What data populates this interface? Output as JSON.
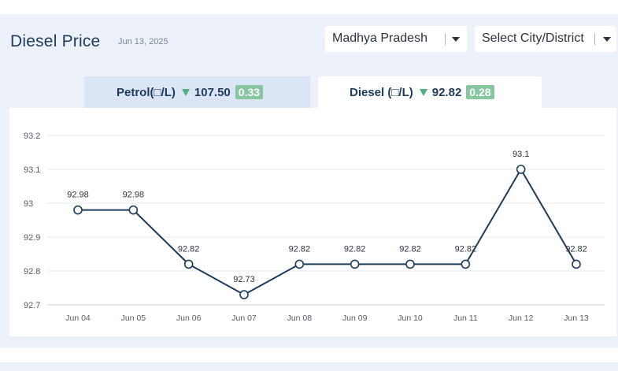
{
  "header": {
    "title": "Diesel Price",
    "date": "Jun 13, 2025",
    "state_select": "Madhya Pradesh",
    "city_select": "Select City/District"
  },
  "tabs": [
    {
      "label": "Petrol(□/L)",
      "price": "107.50",
      "change": "0.33",
      "active": false
    },
    {
      "label": "Diesel (□/L)",
      "price": "92.82",
      "change": "0.28",
      "active": true
    }
  ],
  "colors": {
    "line": "#1f3b5c",
    "down_arrow": "#4db07f",
    "badge": "#86c79f",
    "panel_bg": "#edf1f9"
  },
  "chart_data": {
    "type": "line",
    "categories": [
      "Jun 04",
      "Jun 05",
      "Jun 06",
      "Jun 07",
      "Jun 08",
      "Jun 09",
      "Jun 10",
      "Jun 11",
      "Jun 12",
      "Jun 13"
    ],
    "values": [
      92.98,
      92.98,
      92.82,
      92.73,
      92.82,
      92.82,
      92.82,
      92.82,
      93.1,
      92.82
    ],
    "data_labels": [
      "92.98",
      "92.98",
      "92.82",
      "92.73",
      "92.82",
      "92.82",
      "92.82",
      "92.82",
      "93.1",
      "92.82"
    ],
    "yticks": [
      "92.7",
      "92.8",
      "92.9",
      "93",
      "93.1",
      "93.2"
    ],
    "ylim": [
      92.7,
      93.2
    ],
    "grid": true,
    "title": "",
    "xlabel": "",
    "ylabel": ""
  }
}
